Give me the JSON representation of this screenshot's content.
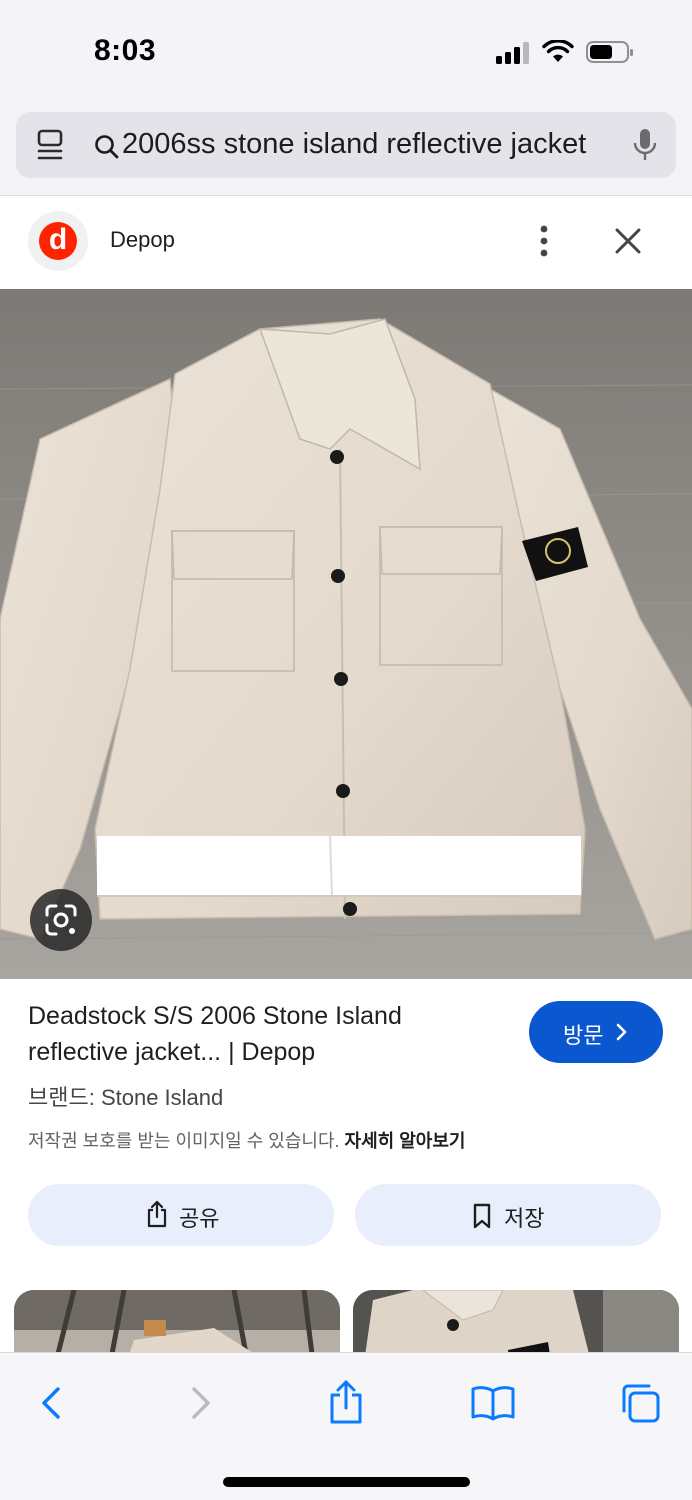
{
  "status_bar": {
    "time": "8:03",
    "battery_level": 0.55
  },
  "browser": {
    "search_query": "2006ss stone island reflective jacket"
  },
  "source": {
    "logo_letter": "d",
    "name": "Depop",
    "brand_color": "#ff2300"
  },
  "result": {
    "title": "Deadstock S/S 2006 Stone Island reflective jacket... | Depop",
    "visit_label": "방문",
    "brand": "브랜드: Stone Island",
    "copyright_notice": "저작권 보호를 받는 이미지일 수 있습니다.",
    "learn_more": "자세히 알아보기",
    "share_label": "공유",
    "save_label": "저장"
  },
  "colors": {
    "accent": "#0b57d0",
    "action_bg": "#e8eefb",
    "browser_chrome": "#f4f3f8"
  },
  "toolbar": {
    "icons": [
      "back-icon",
      "forward-icon",
      "share-icon",
      "bookmarks-icon",
      "tabs-icon"
    ]
  }
}
